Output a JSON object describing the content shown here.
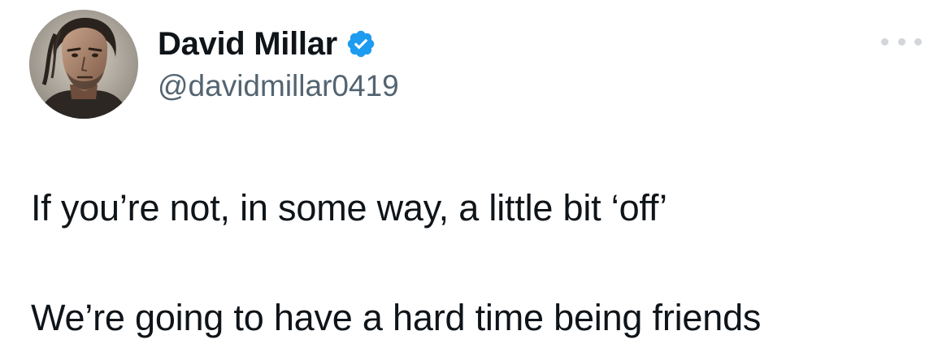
{
  "author": {
    "display_name": "David Millar",
    "handle": "@davidmillar0419",
    "verified": true,
    "avatar": "avatar-photo",
    "verified_badge_color": "#1d9bf0"
  },
  "actions": {
    "more_icon": "more-horizontal-icon"
  },
  "tweet": {
    "lines": [
      "If you’re not, in some way, a little bit ‘off’",
      "We’re going to have a hard time being friends"
    ]
  },
  "colors": {
    "text_primary": "#0f1419",
    "text_secondary": "#536471",
    "accent": "#1d9bf0"
  }
}
